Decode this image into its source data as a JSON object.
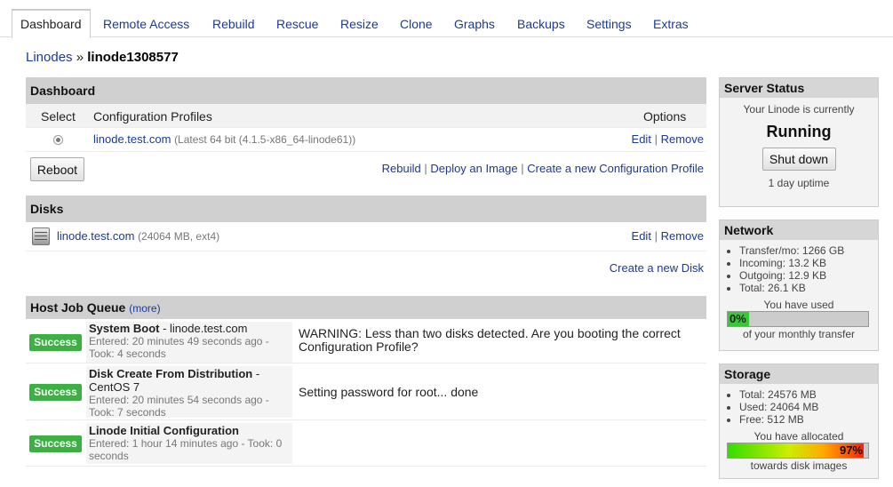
{
  "tabs": [
    {
      "label": "Dashboard"
    },
    {
      "label": "Remote Access"
    },
    {
      "label": "Rebuild"
    },
    {
      "label": "Rescue"
    },
    {
      "label": "Resize"
    },
    {
      "label": "Clone"
    },
    {
      "label": "Graphs"
    },
    {
      "label": "Backups"
    },
    {
      "label": "Settings"
    },
    {
      "label": "Extras"
    }
  ],
  "breadcrumb": {
    "parent": "Linodes",
    "separator": "»",
    "current": "linode1308577"
  },
  "dashboard": {
    "title": "Dashboard",
    "col_select": "Select",
    "col_profiles": "Configuration Profiles",
    "col_options": "Options",
    "profile": {
      "name": "linode.test.com",
      "detail": "(Latest 64 bit (4.1.5-x86_64-linode61))",
      "edit": "Edit",
      "sep": "|",
      "remove": "Remove"
    },
    "reboot_label": "Reboot",
    "actions": {
      "rebuild": "Rebuild",
      "deploy": "Deploy an Image",
      "create_profile": "Create a new Configuration Profile",
      "sep": "|"
    }
  },
  "disks": {
    "title": "Disks",
    "disk": {
      "name": "linode.test.com",
      "detail": "(24064 MB, ext4)",
      "edit": "Edit",
      "sep": "|",
      "remove": "Remove"
    },
    "create_label": "Create a new Disk"
  },
  "jobs": {
    "title": "Host Job Queue",
    "more": "(more)",
    "items": [
      {
        "status": "Success",
        "name": "System Boot",
        "name_suffix": " - linode.test.com",
        "meta": "Entered: 20 minutes 49 seconds ago - Took: 4 seconds",
        "message": "WARNING: Less than two disks detected. Are you booting the correct Configuration Profile?"
      },
      {
        "status": "Success",
        "name": "Disk Create From Distribution",
        "name_suffix": " - CentOS 7",
        "meta": "Entered: 20 minutes 54 seconds ago - Took: 7 seconds",
        "message": "Setting password for root... done"
      },
      {
        "status": "Success",
        "name": "Linode Initial Configuration",
        "name_suffix": "",
        "meta": "Entered: 1 hour 14 minutes ago - Took: 0 seconds",
        "message": ""
      }
    ]
  },
  "server_status": {
    "title": "Server Status",
    "caption": "Your Linode is currently",
    "state": "Running",
    "button": "Shut down",
    "uptime": "1 day uptime"
  },
  "network": {
    "title": "Network",
    "items": [
      "Transfer/mo: 1266 GB",
      "Incoming: 13.2 KB",
      "Outgoing: 12.9 KB",
      "Total: 26.1 KB"
    ],
    "used_label": "You have used",
    "percent_text": "0%",
    "percent": 0,
    "footer": "of your monthly transfer"
  },
  "storage": {
    "title": "Storage",
    "items": [
      "Total: 24576 MB",
      "Used: 24064 MB",
      "Free: 512 MB"
    ],
    "allocated_label": "You have allocated",
    "percent_text": "97%",
    "percent": 97,
    "footer": "towards disk images"
  },
  "colors": {
    "link": "#1a3a9c",
    "success": "#3cb043",
    "header_bg": "#d0d0d0"
  }
}
